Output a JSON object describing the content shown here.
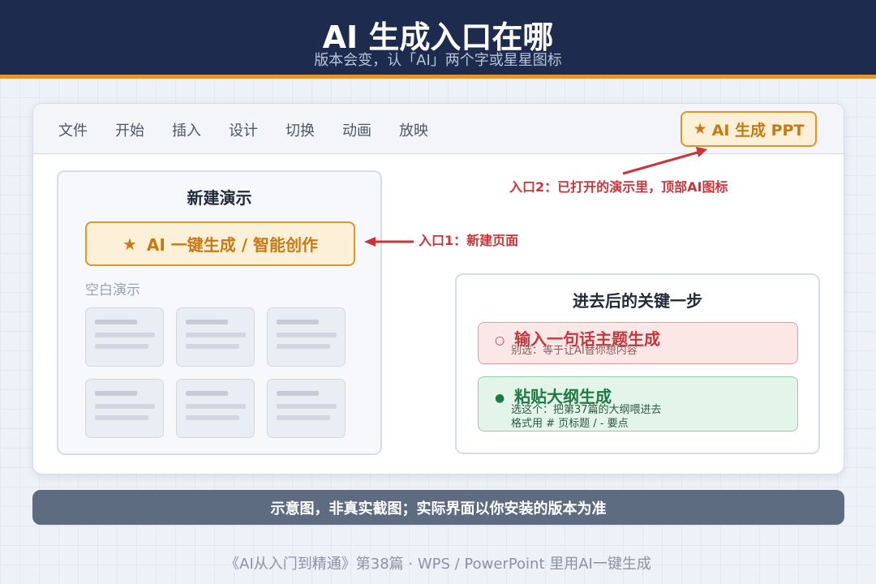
{
  "header": {
    "title": "AI 生成入口在哪",
    "subtitle": "版本会变，认「AI」两个字或星星图标"
  },
  "ribbon": {
    "tabs": [
      "文件",
      "开始",
      "插入",
      "设计",
      "切换",
      "动画",
      "放映"
    ],
    "ai_button": {
      "icon": "★",
      "label": "AI 生成 PPT"
    }
  },
  "new_panel": {
    "title": "新建演示",
    "ai_button": {
      "icon": "★",
      "label": "AI 一键生成 / 智能创作"
    },
    "blank_label": "空白演示"
  },
  "callouts": {
    "entry1": "入口1：新建页面",
    "entry2": "入口2：已打开的演示里，顶部AI图标"
  },
  "step_panel": {
    "title": "进去后的关键一步",
    "options": [
      {
        "bullet": "○",
        "title": "输入一句话主题生成",
        "sub": "别选：等于让AI替你想内容"
      },
      {
        "bullet": "●",
        "title": "粘贴大纲生成",
        "sub1": "选这个：把第37篇的大纲喂进去",
        "sub2": "格式用 # 页标题 / - 要点"
      }
    ]
  },
  "footer": {
    "notice": "示意图，非真实截图；实际界面以你安装的版本为准",
    "series": "《AI从入门到精通》第38篇 · WPS / PowerPoint 里用AI一键生成"
  },
  "colors": {
    "header_bg": "#1d2b4f",
    "accent_orange": "#e0952c",
    "callout_red": "#c8353b",
    "option_bad": "#c0393f",
    "option_good": "#1f7a45"
  }
}
